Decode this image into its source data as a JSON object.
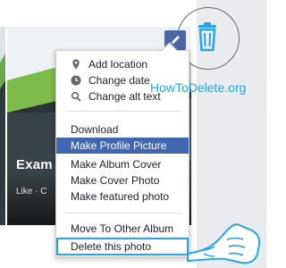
{
  "photo": {
    "title": "Exam",
    "actions_text": "Like · C"
  },
  "menu": {
    "items": [
      {
        "label": "Add location",
        "icon": "location-pin-icon"
      },
      {
        "label": "Change date",
        "icon": "clock-icon"
      },
      {
        "label": "Change alt text",
        "icon": "magnifier-icon"
      },
      {
        "label": "Download"
      },
      {
        "label": "Make Profile Picture"
      },
      {
        "label": "Make Album Cover"
      },
      {
        "label": "Make Cover Photo"
      },
      {
        "label": "Make featured photo"
      },
      {
        "label": "Move To Other Album"
      },
      {
        "label": "Delete this photo"
      }
    ]
  },
  "watermark": "HowToDelete.org",
  "colors": {
    "accent": "#4267b2",
    "watermark": "#27a4e3",
    "icon_gray": "#606770",
    "background_gray": "#e9ebee"
  }
}
